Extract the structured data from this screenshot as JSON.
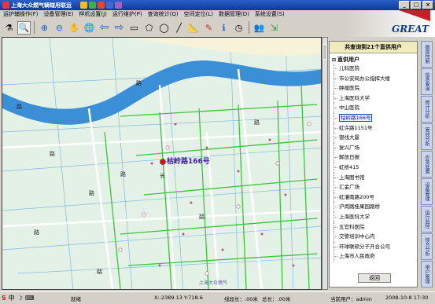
{
  "window": {
    "title": "上海大众燃气辆辖用联运"
  },
  "menu": [
    {
      "label": "运护辅操作(F)"
    },
    {
      "label": "设备管理(E)"
    },
    {
      "label": "样机设置(J)"
    },
    {
      "label": "运行维护(P)"
    },
    {
      "label": "查询统计(Q)"
    },
    {
      "label": "空间定位(L)"
    },
    {
      "label": "数据管理(D)"
    },
    {
      "label": "系统设置(S)"
    }
  ],
  "brand": {
    "logo_text": "GREAT"
  },
  "toolbar_icons": [
    "flask-icon",
    "zoom-tool-icon",
    "zoom-in-icon",
    "zoom-out-icon",
    "hand-pan-icon",
    "globe-icon",
    "back-arrow-icon",
    "forward-arrow-icon",
    "rectangle-select-icon",
    "polygon-select-icon",
    "circle-select-icon",
    "line-tool-icon",
    "measure-icon",
    "pin-icon",
    "info-icon",
    "clock-icon",
    "users-icon",
    "export-icon"
  ],
  "map": {
    "marker_label": "枯岭路166号",
    "labels": [
      "上海大众燃气",
      "路",
      "路",
      "路",
      "长",
      "路",
      "路",
      "路",
      "路",
      "路",
      "路"
    ],
    "colors": {
      "river": "#3a8fd6",
      "green": "#3ec33e",
      "road": "#ffffff",
      "pipe": "#c84b8b"
    }
  },
  "panel": {
    "header": "共查询到21个直供用户",
    "root": "直供用户",
    "items": [
      "儿科医院",
      "市公安局办公指挥大楼",
      "肿瘤医院",
      "上海医科大学",
      "中山医院",
      "牯岭路166号",
      "虹许路1151号",
      "银线大厦",
      "复兴广场",
      "解放日报",
      "虹桥415",
      "上海图书馆",
      "汇金广场",
      "虹漕南路200号",
      "沪闵路桂果园路桥",
      "上海医科大学",
      "五官科医院",
      "交警培训中心内",
      "环球联硕分子开合公司",
      "上海市人民政府"
    ],
    "selected_index": 5,
    "return_label": "返回"
  },
  "side_tabs": [
    "图层控制",
    "信息查询",
    "统计分析",
    "管线分析",
    "应急处置",
    "设备管理",
    "运行监控",
    "综合分析",
    "用户管理"
  ],
  "status": {
    "ime": "中",
    "ready": "就绪",
    "coords": "X:-2389.13  Y:718.6",
    "line_length": "线段长：.00米",
    "total_length": "总长：.00米",
    "user": "当前用户：admin",
    "datetime": "2008-10-8     17:30"
  }
}
